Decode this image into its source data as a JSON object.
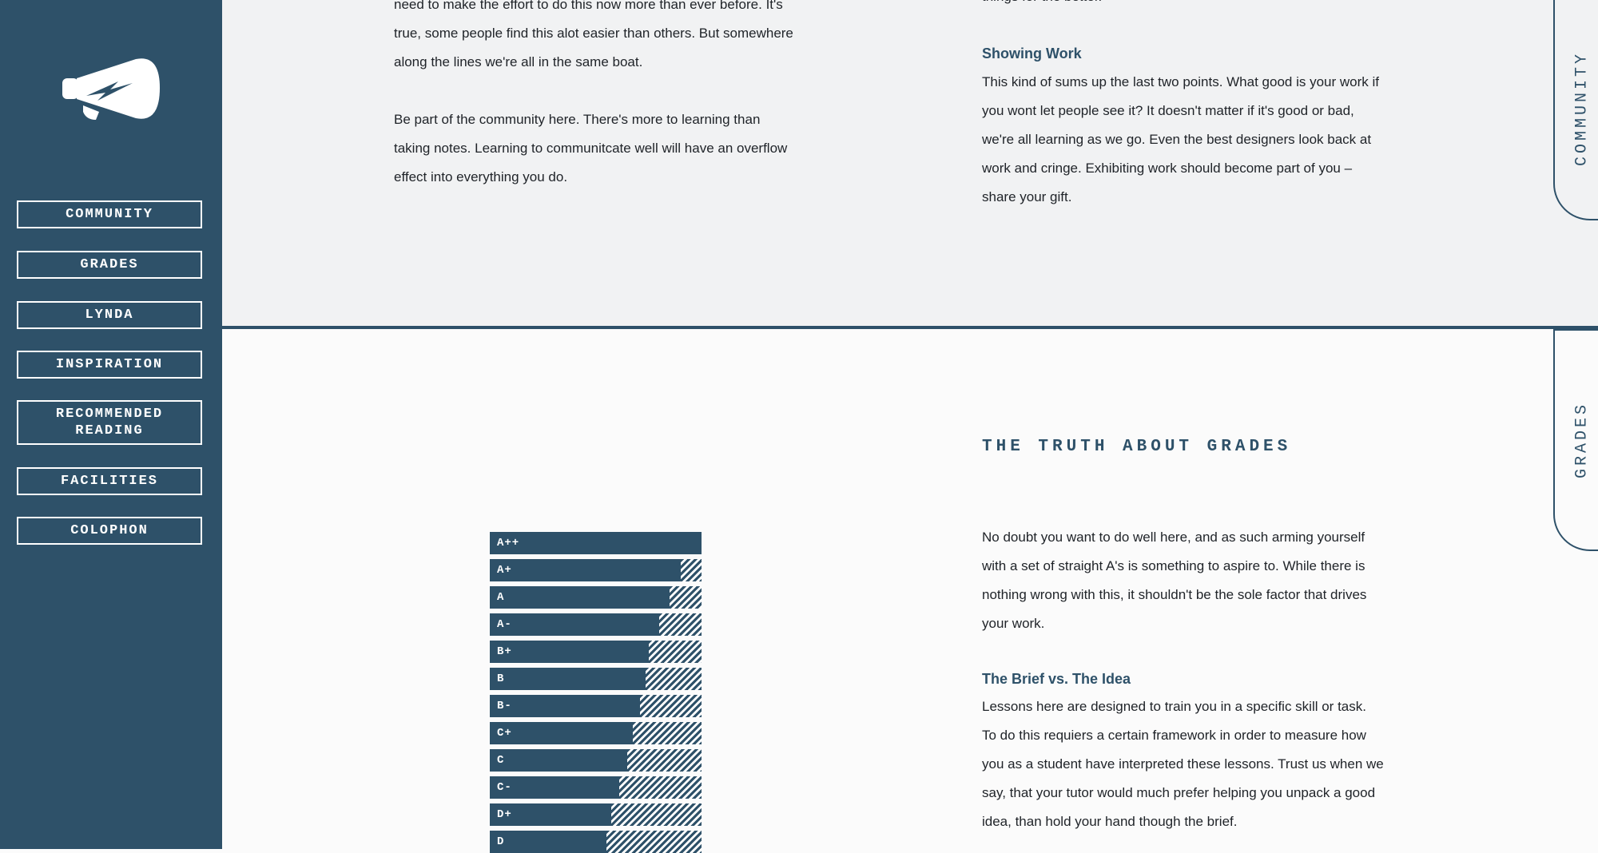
{
  "sidebar": {
    "nav": [
      {
        "label": "COMMUNITY"
      },
      {
        "label": "GRADES"
      },
      {
        "label": "LYNDA"
      },
      {
        "label": "INSPIRATION"
      },
      {
        "label": "RECOMMENDED READING"
      },
      {
        "label": "FACILITIES"
      },
      {
        "label": "COLOPHON"
      }
    ],
    "logo_icon": "megaphone-icon"
  },
  "community": {
    "left_paragraph_1_lines": [
      "need to make the effort to do this now more than ever before. It's",
      "true, some people find this alot easier than others. But somewhere",
      "along the lines we're all in the same boat."
    ],
    "left_paragraph_2_lines": [
      "Be part of the community here. There's more to learning than",
      "taking notes. Learning to communitcate well will have an overflow",
      "effect into everything you do."
    ],
    "right_top_line": "things for the better.",
    "showing_work_heading": "Showing Work",
    "showing_work_lines": [
      "This kind of sums up the last two points. What good is your work if",
      "you wont let people see it? It doesn't matter if it's good or bad,",
      "we're all learning as we go. Even the best designers look back at",
      "work and cringe. Exhibiting work should become part of you –",
      "share your gift."
    ]
  },
  "grades": {
    "title": "THE TRUTH ABOUT GRADES",
    "intro_lines": [
      "No doubt you want to do well here, and as such arming yourself",
      "with a set of straight A's is something to aspire to. While there is",
      "nothing wrong with this, it shouldn't be the sole factor that drives",
      "your work."
    ],
    "brief_heading": "The Brief vs. The Idea",
    "brief_lines": [
      "Lessons here are designed to train you in a specific skill or task.",
      "To do this requiers a certain framework in order to measure how",
      "you as a student have interpreted these lessons. Trust us when we",
      "say, that your tutor would much prefer helping you unpack a good",
      "idea, than hold your hand though the brief."
    ],
    "chart": [
      {
        "label": "A++",
        "fill": 1.0
      },
      {
        "label": "A+",
        "fill": 0.9
      },
      {
        "label": "A",
        "fill": 0.85
      },
      {
        "label": "A-",
        "fill": 0.8
      },
      {
        "label": "B+",
        "fill": 0.75
      },
      {
        "label": "B",
        "fill": 0.735
      },
      {
        "label": "B-",
        "fill": 0.71
      },
      {
        "label": "C+",
        "fill": 0.675
      },
      {
        "label": "C",
        "fill": 0.65
      },
      {
        "label": "C-",
        "fill": 0.61
      },
      {
        "label": "D+",
        "fill": 0.575
      },
      {
        "label": "D",
        "fill": 0.55
      }
    ]
  },
  "side_tabs": [
    {
      "label": "COMMUNITY"
    },
    {
      "label": "GRADES"
    }
  ],
  "colors": {
    "brand": "#2e5169",
    "text": "#1f2328",
    "top_background": "#f1f2f3",
    "bottom_background": "#fbfbfb"
  }
}
